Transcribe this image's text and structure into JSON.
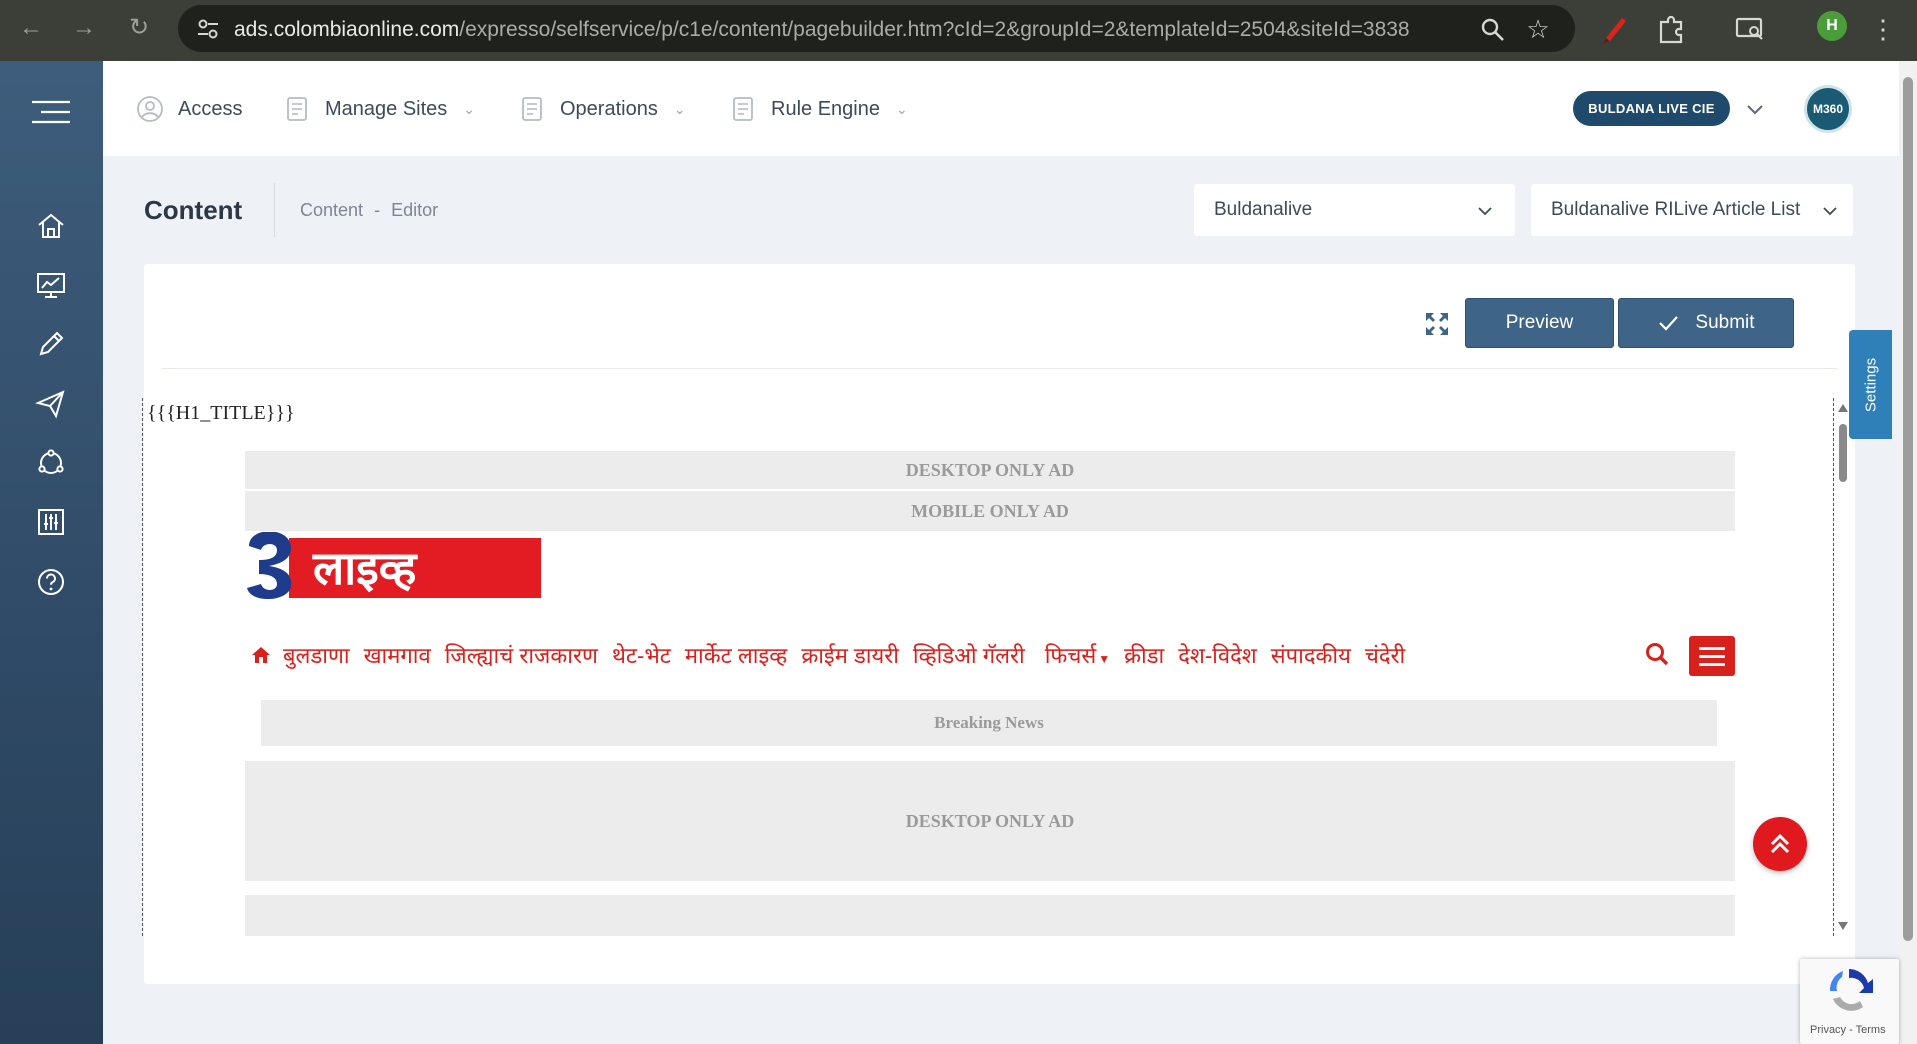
{
  "browser": {
    "url_host": "ads.colombiaonline.com",
    "url_path": "/expresso/selfservice/p/c1e/content/pagebuilder.htm?cId=2&groupId=2&templateId=2504&siteId=3838",
    "profile_initial": "H"
  },
  "topnav": {
    "items": [
      {
        "label": "Access",
        "icon": "user-circle-icon",
        "has_dropdown": false
      },
      {
        "label": "Manage Sites",
        "icon": "document-icon",
        "has_dropdown": true
      },
      {
        "label": "Operations",
        "icon": "document-icon",
        "has_dropdown": true
      },
      {
        "label": "Rule Engine",
        "icon": "document-icon",
        "has_dropdown": true
      }
    ],
    "account_badge": "BULDANA LIVE CIE",
    "avatar_label": "M360"
  },
  "sidebar": {
    "icons": [
      "home-icon",
      "monitor-chart-icon",
      "pencil-icon",
      "paper-plane-icon",
      "cycle-icon",
      "sliders-icon",
      "help-icon"
    ]
  },
  "page": {
    "title": "Content",
    "breadcrumb": {
      "first": "Content",
      "separator": "-",
      "second": "Editor"
    },
    "site_select": "Buldanalive",
    "template_select": "Buldanalive RILive Article List"
  },
  "toolbar": {
    "preview_label": "Preview",
    "submit_label": "Submit"
  },
  "settings_tab": "Settings",
  "preview": {
    "h1_placeholder": "{{{H1_TITLE}}}",
    "desktop_ad": "DESKTOP ONLY AD",
    "mobile_ad": "MOBILE ONLY AD",
    "logo_text": "लाइव्ह",
    "nav_items": [
      "बुलडाणा",
      "खामगाव",
      "जिल्ह्याचं राजकारण",
      "थेट-भेट",
      "मार्केट लाइव्ह",
      "क्राईम डायरी",
      "व्हिडिओ गॅलरी",
      "फिचर्स",
      "क्रीडा",
      "देश-विदेश",
      "संपादकीय",
      "चंदेरी"
    ],
    "breaking_news": "Breaking News",
    "desktop_ad_2": "DESKTOP ONLY AD"
  },
  "recaptcha": {
    "privacy": "Privacy",
    "separator": "-",
    "terms": "Terms"
  },
  "colors": {
    "sidebar": "#34516f",
    "accent_button": "#3e6587",
    "site_red": "#d8201c",
    "settings_tab": "#2f7fb8"
  }
}
